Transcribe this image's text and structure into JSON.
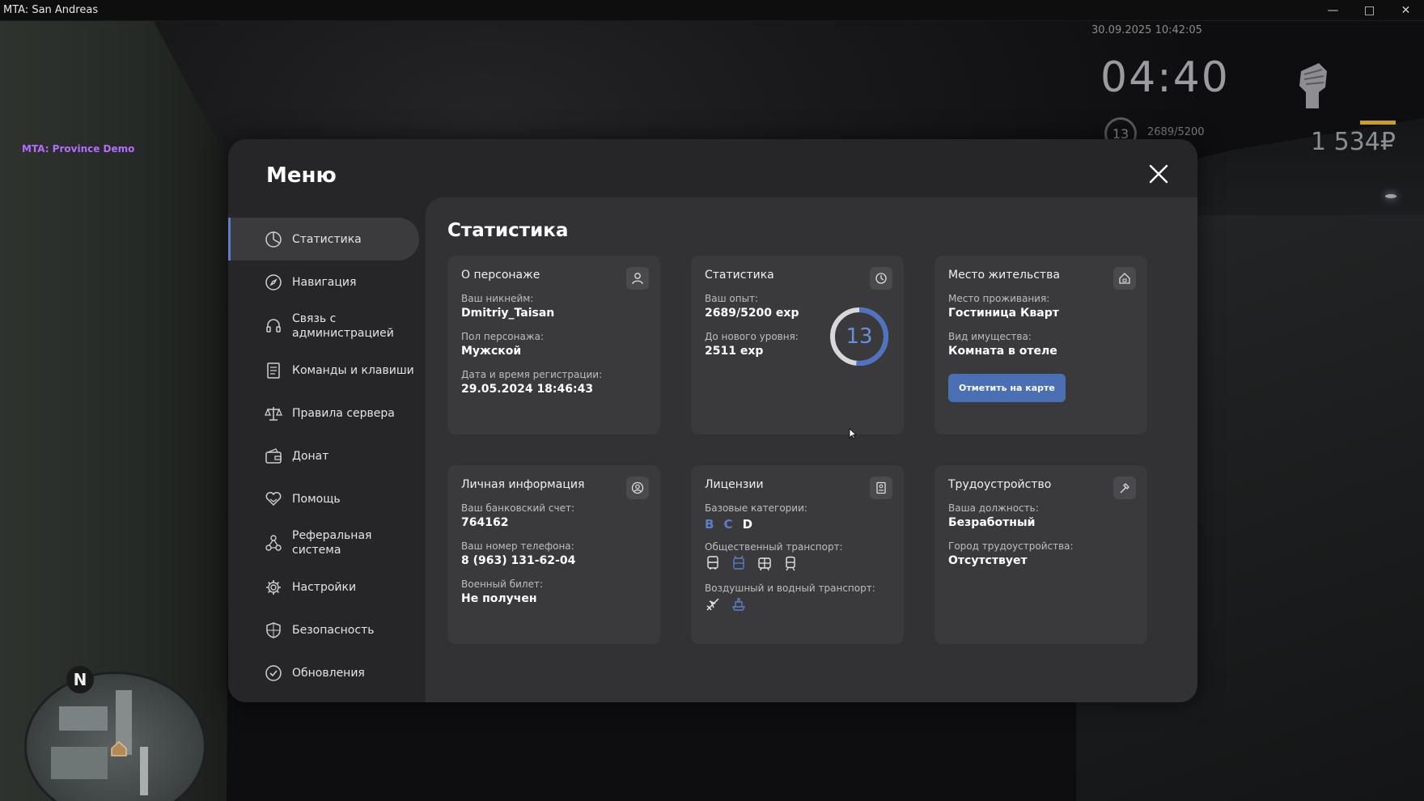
{
  "window": {
    "title": "MTA: San Andreas"
  },
  "overlay": {
    "server_label": "MTA: Province Demo"
  },
  "hud": {
    "datetime": "30.09.2025 10:42:05",
    "clock": "04:40",
    "level": "13",
    "exp": "2689/5200",
    "money": "1 534₽",
    "minimap_north": "N"
  },
  "menu": {
    "title": "Меню",
    "nav": [
      {
        "label": "Статистика",
        "icon": "statistics-icon"
      },
      {
        "label": "Навигация",
        "icon": "compass-icon"
      },
      {
        "label": "Связь с администрацией",
        "icon": "headset-icon"
      },
      {
        "label": "Команды и клавиши",
        "icon": "document-icon"
      },
      {
        "label": "Правила сервера",
        "icon": "scales-icon"
      },
      {
        "label": "Донат",
        "icon": "wallet-icon"
      },
      {
        "label": "Помощь",
        "icon": "heart-hand-icon"
      },
      {
        "label": "Реферальная система",
        "icon": "referral-icon"
      },
      {
        "label": "Настройки",
        "icon": "gear-icon"
      },
      {
        "label": "Безопасность",
        "icon": "shield-icon"
      },
      {
        "label": "Обновления",
        "icon": "check-circle-icon"
      }
    ]
  },
  "page": {
    "title": "Статистика",
    "character": {
      "title": "О персонаже",
      "nick_label": "Ваш никнейм:",
      "nick": "Dmitriy_Taisan",
      "gender_label": "Пол персонажа:",
      "gender": "Мужской",
      "reg_label": "Дата и время регистрации:",
      "reg": "29.05.2024 18:46:43"
    },
    "stats": {
      "title": "Статистика",
      "exp_label": "Ваш опыт:",
      "exp": "2689/5200 exp",
      "next_label": "До нового уровня:",
      "next": "2511 exp",
      "level": "13",
      "progress": 0.517
    },
    "residence": {
      "title": "Место жительства",
      "place_label": "Место проживания:",
      "place": "Гостиница Кварт",
      "prop_label": "Вид имущества:",
      "prop": "Комната в отеле",
      "button": "Отметить на карте"
    },
    "personal": {
      "title": "Личная информация",
      "bank_label": "Ваш банковский счет:",
      "bank": "764162",
      "phone_label": "Ваш номер телефона:",
      "phone": "8 (963) 131-62-04",
      "military_label": "Военный билет:",
      "military": "Не получен"
    },
    "licenses": {
      "title": "Лицензии",
      "base_label": "Базовые категории:",
      "categories": [
        "B",
        "C",
        "D"
      ],
      "category_colors": [
        "#5b7fc7",
        "#5b7fc7",
        "#ffffff"
      ],
      "public_label": "Общественный транспорт:",
      "air_label": "Воздушный и водный транспорт:"
    },
    "job": {
      "title": "Трудоустройство",
      "position_label": "Ваша должность:",
      "position": "Безработный",
      "city_label": "Город трудоустройства:",
      "city": "Отсутствует"
    }
  }
}
